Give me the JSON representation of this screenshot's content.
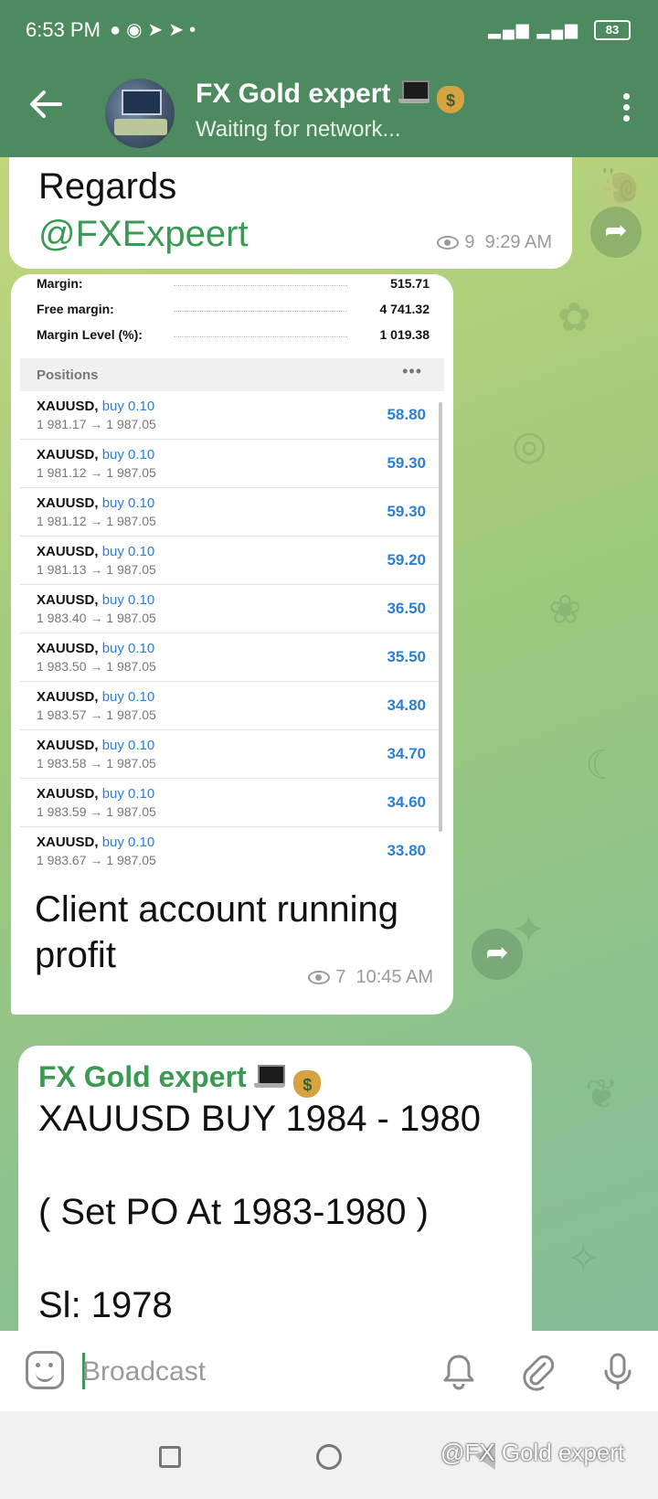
{
  "status_bar": {
    "time": "6:53 PM",
    "notification_icons": [
      "chat-bubble-icon",
      "messenger-icon",
      "telegram-icon",
      "telegram-icon",
      "dot-icon"
    ],
    "battery": "83"
  },
  "header": {
    "title": "FX Gold expert",
    "subtitle": "Waiting for network..."
  },
  "messages": [
    {
      "id": "m1",
      "lines": [
        "Regards",
        "@FXExpeert"
      ],
      "views": "9",
      "time": "9:29 AM"
    },
    {
      "id": "m2",
      "account": [
        {
          "label": "Margin:",
          "value": "515.71"
        },
        {
          "label": "Free margin:",
          "value": "4 741.32"
        },
        {
          "label": "Margin Level (%):",
          "value": "1 019.38"
        }
      ],
      "positions_title": "Positions",
      "positions_menu": "•••",
      "positions": [
        {
          "symbol": "XAUUSD,",
          "dir": "buy 0.10",
          "prices": "1 981.17 → 1 987.05",
          "profit": "58.80"
        },
        {
          "symbol": "XAUUSD,",
          "dir": "buy 0.10",
          "prices": "1 981.12 → 1 987.05",
          "profit": "59.30"
        },
        {
          "symbol": "XAUUSD,",
          "dir": "buy 0.10",
          "prices": "1 981.12 → 1 987.05",
          "profit": "59.30"
        },
        {
          "symbol": "XAUUSD,",
          "dir": "buy 0.10",
          "prices": "1 981.13 → 1 987.05",
          "profit": "59.20"
        },
        {
          "symbol": "XAUUSD,",
          "dir": "buy 0.10",
          "prices": "1 983.40 → 1 987.05",
          "profit": "36.50"
        },
        {
          "symbol": "XAUUSD,",
          "dir": "buy 0.10",
          "prices": "1 983.50 → 1 987.05",
          "profit": "35.50"
        },
        {
          "symbol": "XAUUSD,",
          "dir": "buy 0.10",
          "prices": "1 983.57 → 1 987.05",
          "profit": "34.80"
        },
        {
          "symbol": "XAUUSD,",
          "dir": "buy 0.10",
          "prices": "1 983.58 → 1 987.05",
          "profit": "34.70"
        },
        {
          "symbol": "XAUUSD,",
          "dir": "buy 0.10",
          "prices": "1 983.59 → 1 987.05",
          "profit": "34.60"
        },
        {
          "symbol": "XAUUSD,",
          "dir": "buy 0.10",
          "prices": "1 983.67 → 1 987.05",
          "profit": "33.80"
        }
      ],
      "caption": "Client account running profit",
      "views": "7",
      "time": "10:45 AM"
    },
    {
      "id": "m3",
      "sender": "FX Gold expert",
      "lines": [
        "XAUUSD BUY 1984 - 1980",
        "( Set PO At 1983-1980 )",
        "Sl: 1978"
      ]
    }
  ],
  "input": {
    "placeholder": "Broadcast"
  },
  "watermark": "@FX Gold expert",
  "colors": {
    "header": "#4e8a5f",
    "accent_green": "#3a9a53",
    "profit_blue": "#2a7fd6"
  }
}
